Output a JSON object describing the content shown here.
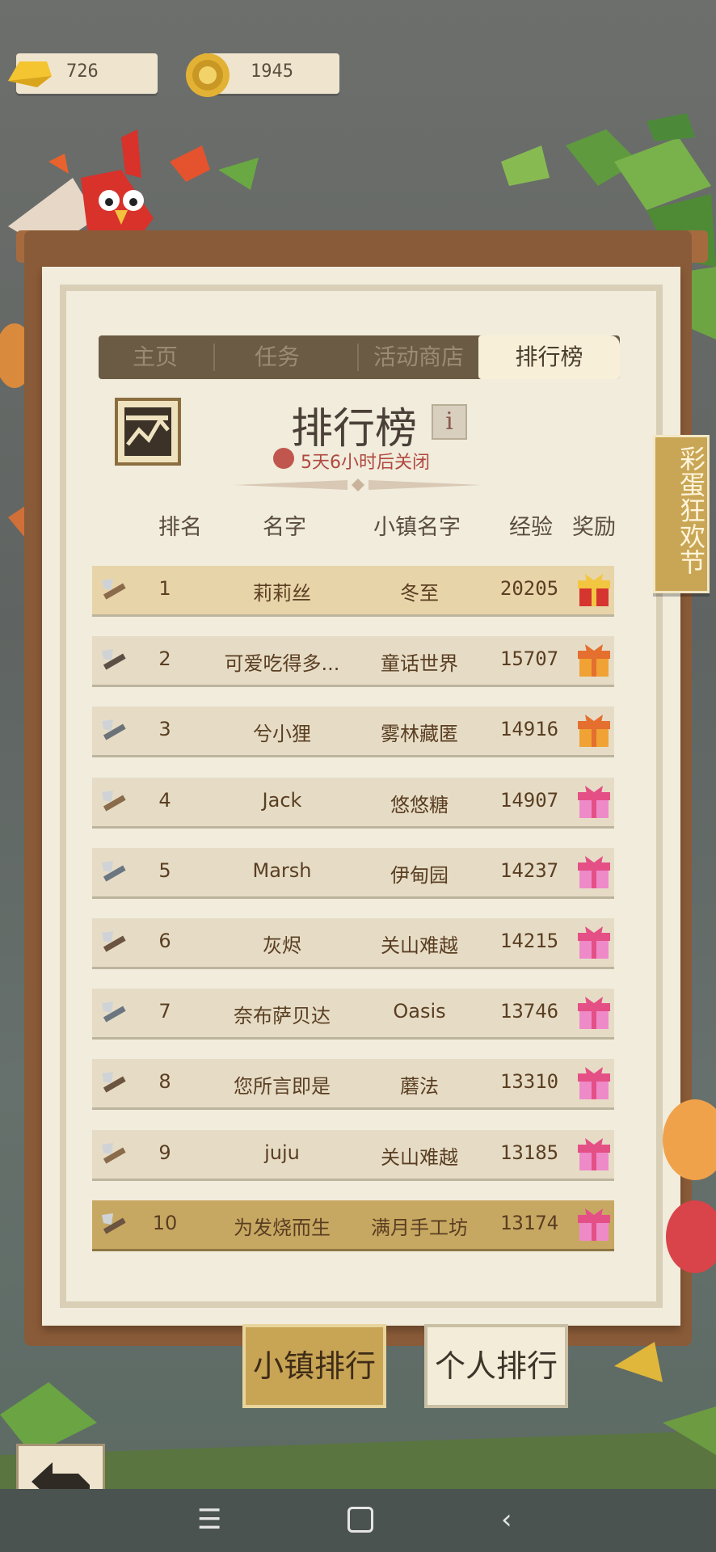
{
  "currency": {
    "gold": "726",
    "coins": "1945"
  },
  "tabs": [
    "主页",
    "任务",
    "活动商店",
    "排行榜"
  ],
  "active_tab": 3,
  "leaderboard": {
    "title": "排行榜",
    "timer": "5天6小时后关闭",
    "columns": [
      "排名",
      "名字",
      "小镇名字",
      "经验",
      "奖励"
    ],
    "rows": [
      {
        "rank": "1",
        "name": "莉莉丝",
        "town": "冬至",
        "exp": "20205",
        "tool": "axe-bolt-icon",
        "gift": "red-gift-icon"
      },
      {
        "rank": "2",
        "name": "可爱吃得多...",
        "town": "童话世界",
        "exp": "15707",
        "tool": "pickaxe-icon",
        "gift": "orange-gift-icon"
      },
      {
        "rank": "3",
        "name": "兮小狸",
        "town": "雾林藏匿",
        "exp": "14916",
        "tool": "scissors-icon",
        "gift": "orange-gift-icon"
      },
      {
        "rank": "4",
        "name": "Jack",
        "town": "悠悠糖",
        "exp": "14907",
        "tool": "axe-bolt-icon",
        "gift": "pink-gift-icon"
      },
      {
        "rank": "5",
        "name": "Marsh",
        "town": "伊甸园",
        "exp": "14237",
        "tool": "saw-icon",
        "gift": "pink-gift-icon"
      },
      {
        "rank": "6",
        "name": "灰烬",
        "town": "关山难越",
        "exp": "14215",
        "tool": "hammer-icon",
        "gift": "pink-gift-icon"
      },
      {
        "rank": "7",
        "name": "奈布萨贝达",
        "town": "Oasis",
        "exp": "13746",
        "tool": "saw-icon",
        "gift": "pink-gift-icon"
      },
      {
        "rank": "8",
        "name": "您所言即是",
        "town": "蘑法",
        "exp": "13310",
        "tool": "hammer-icon",
        "gift": "pink-gift-icon"
      },
      {
        "rank": "9",
        "name": "juju",
        "town": "关山难越",
        "exp": "13185",
        "tool": "axe-bolt-icon",
        "gift": "pink-gift-icon"
      },
      {
        "rank": "10",
        "name": "为发烧而生",
        "town": "满月手工坊",
        "exp": "13174",
        "tool": "hammer-icon",
        "gift": "pink-gift-icon"
      }
    ]
  },
  "side_banner": "彩蛋狂欢节",
  "buttons": {
    "town_rank": "小镇排行",
    "personal_rank": "个人排行"
  },
  "colors": {
    "accent_gold": "#c8a455",
    "board_wood": "#8a5b38",
    "paper": "#f1ecdc",
    "timer_red": "#b04840"
  }
}
